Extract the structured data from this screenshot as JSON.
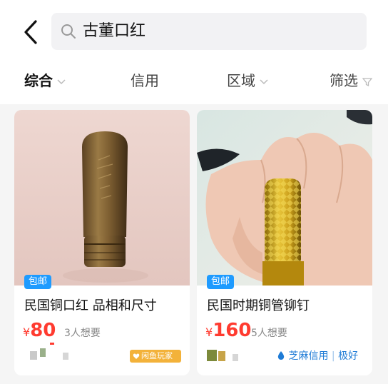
{
  "search": {
    "query": "古董口红"
  },
  "filters": {
    "comprehensive": "综合",
    "credit": "信用",
    "region": "区域",
    "filter": "筛选"
  },
  "products": [
    {
      "badge": "包邮",
      "title": "民国铜口红 品相和尺寸",
      "currency": "¥",
      "price": "80",
      "wants": "3人想要",
      "seller_badge": "闲鱼玩家"
    },
    {
      "badge": "包邮",
      "title": "民国时期铜管铆钉",
      "currency": "¥",
      "price": "160",
      "wants": "5人想要",
      "credit": "芝麻信用",
      "credit_level": "极好"
    }
  ],
  "colors": {
    "price": "#ff3b30",
    "badge": "#1e9bff",
    "credit": "#1e7bd6",
    "seller_badge": "#f3b23a"
  },
  "icons": [
    "back-arrow-icon",
    "search-icon",
    "chevron-down-icon",
    "funnel-icon",
    "drop-icon",
    "heart-icon"
  ]
}
